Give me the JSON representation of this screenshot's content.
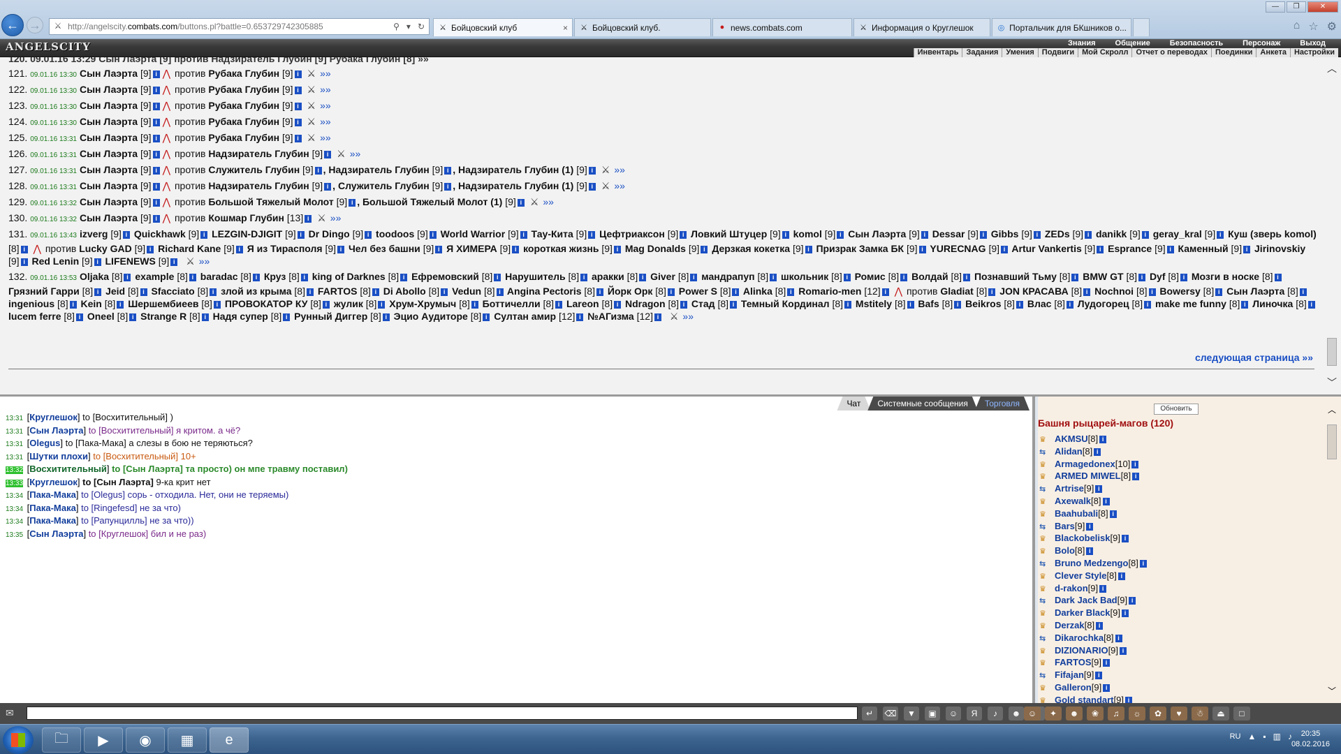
{
  "browser": {
    "url_prefix": "http://angelscity.",
    "url_domain": "combats.com",
    "url_suffix": "/buttons.pl?battle=0.653729742305885",
    "tabs": [
      {
        "label": "Бойцовский клуб",
        "active": true
      },
      {
        "label": "Бойцовский клуб.",
        "active": false
      },
      {
        "label": "news.combats.com",
        "active": false
      },
      {
        "label": "Информация о Круглешок",
        "active": false
      },
      {
        "label": "Портальчик для БКшников о...",
        "active": false
      }
    ]
  },
  "game": {
    "logo": "ANGELSCITY",
    "top_menu": [
      "Знания",
      "Общение",
      "Безопасность",
      "Персонаж",
      "Выход"
    ],
    "sub_menu": [
      "Инвентарь",
      "Задания",
      "Умения",
      "Подвиги",
      "Мой Скролл",
      "Отчет о переводах",
      "Поединки",
      "Анкета",
      "Настройки"
    ]
  },
  "battle_log": {
    "top_cut": "120. 09.01.16 13:29 Сын Лаэрта [9] против Надзиратель Глубин [9] Рубака Глубин [8] »»",
    "fights": [
      {
        "num": "121.",
        "time": "09.01.16 13:30",
        "player": "Сын Лаэрта",
        "plvl": "[9]",
        "vs": "против",
        "enemies": [
          {
            "name": "Рубака Глубин",
            "lvl": "[9]"
          }
        ]
      },
      {
        "num": "122.",
        "time": "09.01.16 13:30",
        "player": "Сын Лаэрта",
        "plvl": "[9]",
        "vs": "против",
        "enemies": [
          {
            "name": "Рубака Глубин",
            "lvl": "[9]"
          }
        ]
      },
      {
        "num": "123.",
        "time": "09.01.16 13:30",
        "player": "Сын Лаэрта",
        "plvl": "[9]",
        "vs": "против",
        "enemies": [
          {
            "name": "Рубака Глубин",
            "lvl": "[9]"
          }
        ]
      },
      {
        "num": "124.",
        "time": "09.01.16 13:30",
        "player": "Сын Лаэрта",
        "plvl": "[9]",
        "vs": "против",
        "enemies": [
          {
            "name": "Рубака Глубин",
            "lvl": "[9]"
          }
        ]
      },
      {
        "num": "125.",
        "time": "09.01.16 13:31",
        "player": "Сын Лаэрта",
        "plvl": "[9]",
        "vs": "против",
        "enemies": [
          {
            "name": "Рубака Глубин",
            "lvl": "[9]"
          }
        ]
      },
      {
        "num": "126.",
        "time": "09.01.16 13:31",
        "player": "Сын Лаэрта",
        "plvl": "[9]",
        "vs": "против",
        "enemies": [
          {
            "name": "Надзиратель Глубин",
            "lvl": "[9]"
          }
        ]
      },
      {
        "num": "127.",
        "time": "09.01.16 13:31",
        "player": "Сын Лаэрта",
        "plvl": "[9]",
        "vs": "против",
        "enemies": [
          {
            "name": "Служитель Глубин",
            "lvl": "[9]"
          },
          {
            "name": "Надзиратель Глубин",
            "lvl": "[9]"
          },
          {
            "name": "Надзиратель Глубин (1)",
            "lvl": "[9]"
          }
        ]
      },
      {
        "num": "128.",
        "time": "09.01.16 13:31",
        "player": "Сын Лаэрта",
        "plvl": "[9]",
        "vs": "против",
        "enemies": [
          {
            "name": "Надзиратель Глубин",
            "lvl": "[9]"
          },
          {
            "name": "Служитель Глубин",
            "lvl": "[9]"
          },
          {
            "name": "Надзиратель Глубин (1)",
            "lvl": "[9]"
          }
        ]
      },
      {
        "num": "129.",
        "time": "09.01.16 13:32",
        "player": "Сын Лаэрта",
        "plvl": "[9]",
        "vs": "против",
        "enemies": [
          {
            "name": "Большой Тяжелый Молот",
            "lvl": "[9]"
          },
          {
            "name": "Большой Тяжелый Молот (1)",
            "lvl": "[9]"
          }
        ]
      },
      {
        "num": "130.",
        "time": "09.01.16 13:32",
        "player": "Сын Лаэрта",
        "plvl": "[9]",
        "vs": "против",
        "enemies": [
          {
            "name": "Кошмар Глубин",
            "lvl": "[13]"
          }
        ]
      }
    ],
    "group_fights": [
      {
        "num": "131.",
        "time": "09.01.16 13:43",
        "side_a": [
          [
            "izverg",
            "[9]"
          ],
          [
            "Quickhawk",
            "[9]"
          ],
          [
            "LEZGIN-DJIGIT",
            "[9]"
          ],
          [
            "Dr Dingo",
            "[9]"
          ],
          [
            "toodoos",
            "[9]"
          ],
          [
            "World Warrior",
            "[9]"
          ],
          [
            "Тау-Кита",
            "[9]"
          ],
          [
            "Цефтриаксон",
            "[9]"
          ],
          [
            "Ловкий Штуцер",
            "[9]"
          ],
          [
            "komol",
            "[9]"
          ],
          [
            "Сын Лаэрта",
            "[9]"
          ],
          [
            "Dessar",
            "[9]"
          ],
          [
            "Gibbs",
            "[9]"
          ],
          [
            "ZEDs",
            "[9]"
          ],
          [
            "danikk",
            "[9]"
          ],
          [
            "geray_kral",
            "[9]"
          ],
          [
            "Куш (зверь komol)",
            "[8]"
          ]
        ],
        "vs": "против",
        "side_b": [
          [
            "Lucky GAD",
            "[9]"
          ],
          [
            "Richard Kane",
            "[9]"
          ],
          [
            "Я из Тирасполя",
            "[9]"
          ],
          [
            "Чел без башни",
            "[9]"
          ],
          [
            "Я ХИМЕРА",
            "[9]"
          ],
          [
            "короткая жизнь",
            "[9]"
          ],
          [
            "Mag Donalds",
            "[9]"
          ],
          [
            "Дерзкая кокетка",
            "[9]"
          ],
          [
            "Призрак Замка БК",
            "[9]"
          ],
          [
            "YURECNAG",
            "[9]"
          ],
          [
            "Artur Vankertis",
            "[9]"
          ],
          [
            "Esprance",
            "[9]"
          ],
          [
            "Каменный",
            "[9]"
          ],
          [
            "Jirinovskiy",
            "[9]"
          ],
          [
            "Red Lenin",
            "[9]"
          ],
          [
            "LIFENEWS",
            "[9]"
          ]
        ]
      },
      {
        "num": "132.",
        "time": "09.01.16 13:53",
        "side_a": [
          [
            "Oljaka",
            "[8]"
          ],
          [
            "example",
            "[8]"
          ],
          [
            "baradac",
            "[8]"
          ],
          [
            "Круз",
            "[8]"
          ],
          [
            "king of Darknes",
            "[8]"
          ],
          [
            "Ефремовский",
            "[8]"
          ],
          [
            "Нарушитель",
            "[8]"
          ],
          [
            "аракки",
            "[8]"
          ],
          [
            "Giver",
            "[8]"
          ],
          [
            "мандрапуп",
            "[8]"
          ],
          [
            "школьник",
            "[8]"
          ],
          [
            "Ромис",
            "[8]"
          ],
          [
            "Волдай",
            "[8]"
          ],
          [
            "Познавший Тьму",
            "[8]"
          ],
          [
            "BMW GT",
            "[8]"
          ],
          [
            "Dyf",
            "[8]"
          ],
          [
            "Мозги в носке",
            "[8]"
          ],
          [
            "Грязний Гарри",
            "[8]"
          ],
          [
            "Jeid",
            "[8]"
          ],
          [
            "Sfacciato",
            "[8]"
          ],
          [
            "злой из крыма",
            "[8]"
          ],
          [
            "FARTOS",
            "[8]"
          ],
          [
            "Di Abollo",
            "[8]"
          ],
          [
            "Vedun",
            "[8]"
          ],
          [
            "Angina Pectoris",
            "[8]"
          ],
          [
            "Йорк Орк",
            "[8]"
          ],
          [
            "Power S",
            "[8]"
          ],
          [
            "Alinka",
            "[8]"
          ],
          [
            "Romario-men",
            "[12]"
          ]
        ],
        "vs": "против",
        "side_b": [
          [
            "Gladiat",
            "[8]"
          ],
          [
            "JON КРАСАВА",
            "[8]"
          ],
          [
            "Nochnoi",
            "[8]"
          ],
          [
            "Bowersy",
            "[8]"
          ],
          [
            "Сын Лаэрта",
            "[8]"
          ],
          [
            "ingenious",
            "[8]"
          ],
          [
            "Kein",
            "[8]"
          ],
          [
            "Шершембиеев",
            "[8]"
          ],
          [
            "ПРОВОКАТОР КУ",
            "[8]"
          ],
          [
            "жулик",
            "[8]"
          ],
          [
            "Хрум-Хрумыч",
            "[8]"
          ],
          [
            "Боттичелли",
            "[8]"
          ],
          [
            "Lareon",
            "[8]"
          ],
          [
            "Ndragon",
            "[8]"
          ],
          [
            "Стад",
            "[8]"
          ],
          [
            "Темный Кординал",
            "[8]"
          ],
          [
            "Mstitely",
            "[8]"
          ],
          [
            "Bafs",
            "[8]"
          ],
          [
            "Beikros",
            "[8]"
          ],
          [
            "Влас",
            "[8]"
          ],
          [
            "Лудогорец",
            "[8]"
          ],
          [
            "make me funny",
            "[8]"
          ],
          [
            "Линочка",
            "[8]"
          ],
          [
            "lucem ferre",
            "[8]"
          ],
          [
            "Oneel",
            "[8]"
          ],
          [
            "Strange R",
            "[8]"
          ],
          [
            "Надя супер",
            "[8]"
          ],
          [
            "Рунный Диггер",
            "[8]"
          ],
          [
            "Эцио Аудиторе",
            "[8]"
          ],
          [
            "Султан амир",
            "[12]"
          ],
          [
            "№АГизма",
            "[12]"
          ]
        ]
      }
    ],
    "more_link": "»»",
    "next_page": "следующая страница »»"
  },
  "chat": {
    "tabs": [
      "Чат",
      "Системные сообщения",
      "Торговля"
    ],
    "messages": [
      {
        "time": "13:31",
        "from": "Круглешок",
        "to": "to [Восхитительный]",
        "text": ")",
        "color": "black",
        "highlight": false
      },
      {
        "time": "13:31",
        "from": "Сын Лаэрта",
        "to": "to [Восхитительный]",
        "text": "я критом. а чё?",
        "color": "purple",
        "highlight": false
      },
      {
        "time": "13:31",
        "from": "Olegus",
        "to": "to [Пака-Мака]",
        "text": "а слезы в бою не теряються?",
        "color": "black",
        "highlight": false
      },
      {
        "time": "13:31",
        "from": "Шутки плохи",
        "to": "to [Восхитительный]",
        "text": "10+",
        "color": "orange",
        "highlight": false
      },
      {
        "time": "13:32",
        "from": "Восхитительный",
        "to": "to [Сын Лаэрта]",
        "text": "та просто) он мпе травму поставил)",
        "color": "green",
        "highlight": true
      },
      {
        "time": "13:33",
        "from": "Круглешок",
        "to": "to [Сын Лаэрта]",
        "text": "9-ка крит нет",
        "color": "black",
        "highlight": true
      },
      {
        "time": "13:34",
        "from": "Пака-Мака",
        "to": "to [Olegus]",
        "text": "сорь - отходила. Нет, они не теряемы)",
        "color": "navy",
        "highlight": false
      },
      {
        "time": "13:34",
        "from": "Пака-Мака",
        "to": "to [Ringefesd]",
        "text": "не за что)",
        "color": "navy",
        "highlight": false
      },
      {
        "time": "13:34",
        "from": "Пака-Мака",
        "to": "to [Рапунцилль]",
        "text": "не за что))",
        "color": "navy",
        "highlight": false
      },
      {
        "time": "13:35",
        "from": "Сын Лаэрта",
        "to": "to [Круглешок]",
        "text": "бил и не раз)",
        "color": "purple",
        "highlight": false
      }
    ]
  },
  "online": {
    "refresh_label": "Обновить",
    "room_title": "Башня рыцарей-магов (120)",
    "users": [
      {
        "name": "AKMSU",
        "lvl": "[8]"
      },
      {
        "name": "Alidan",
        "lvl": "[8]"
      },
      {
        "name": "Armagedonex",
        "lvl": "[10]"
      },
      {
        "name": "ARMED MIWEL",
        "lvl": "[8]"
      },
      {
        "name": "Artrise",
        "lvl": "[9]"
      },
      {
        "name": "Axewalk",
        "lvl": "[8]"
      },
      {
        "name": "Baahubali",
        "lvl": "[8]"
      },
      {
        "name": "Bars",
        "lvl": "[9]"
      },
      {
        "name": "Blackobelisk",
        "lvl": "[9]"
      },
      {
        "name": "Bolo",
        "lvl": "[8]"
      },
      {
        "name": "Bruno Medzengo",
        "lvl": "[8]"
      },
      {
        "name": "Clever Style",
        "lvl": "[8]"
      },
      {
        "name": "d-rakon",
        "lvl": "[9]"
      },
      {
        "name": "Dark Jack Bad",
        "lvl": "[9]"
      },
      {
        "name": "Darker Black",
        "lvl": "[9]"
      },
      {
        "name": "Derzak",
        "lvl": "[8]"
      },
      {
        "name": "Dikarochka",
        "lvl": "[8]"
      },
      {
        "name": "DIZIONARIO",
        "lvl": "[9]"
      },
      {
        "name": "FARTOS",
        "lvl": "[9]"
      },
      {
        "name": "Fifajan",
        "lvl": "[9]"
      },
      {
        "name": "Galleron",
        "lvl": "[9]"
      },
      {
        "name": "Gold standart",
        "lvl": "[9]"
      }
    ]
  },
  "taskbar": {
    "lang": "RU",
    "time": "20:35",
    "date": "08.02.2016"
  }
}
